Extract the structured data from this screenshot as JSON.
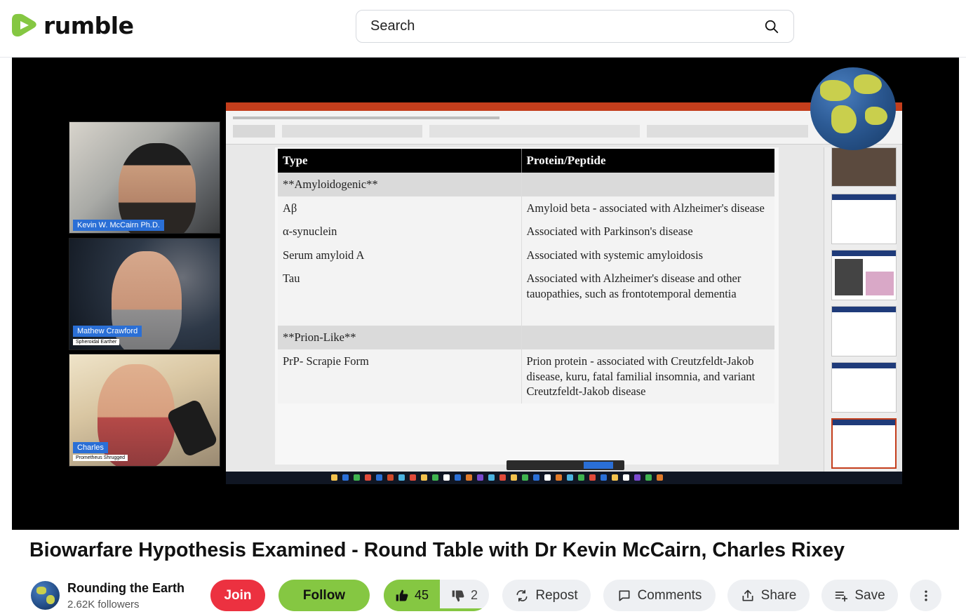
{
  "brand": {
    "name": "rumble",
    "accent": "#85c742"
  },
  "search": {
    "placeholder": "Search"
  },
  "video": {
    "participants": [
      {
        "name": "Kevin W. McCairn Ph.D.",
        "subtitle": ""
      },
      {
        "name": "Mathew Crawford",
        "subtitle": "Spheroidal Earther"
      },
      {
        "name": "Charles",
        "subtitle": "Prometheus Shrugged"
      }
    ],
    "slide": {
      "headers": [
        "Type",
        "Protein/Peptide"
      ],
      "sections": [
        {
          "title": "**Amyloidogenic**",
          "rows": [
            [
              "Aβ",
              "Amyloid beta - associated with Alzheimer's disease"
            ],
            [
              "α-synuclein",
              "Associated with Parkinson's disease"
            ],
            [
              "Serum amyloid A",
              "Associated with systemic amyloidosis"
            ],
            [
              "Tau",
              "Associated with Alzheimer's disease and other tauopathies, such as frontotemporal dementia"
            ]
          ]
        },
        {
          "title": "**Prion-Like**",
          "rows": [
            [
              "PrP- Scrapie Form",
              "Prion protein - associated with Creutzfeldt-Jakob disease, kuru, fatal familial insomnia, and variant Creutzfeldt-Jakob disease"
            ]
          ]
        }
      ]
    }
  },
  "title": "Biowarfare Hypothesis Examined - Round Table with Dr Kevin McCairn, Charles Rixey",
  "channel": {
    "name": "Rounding the Earth",
    "followers": "2.62K followers"
  },
  "actions": {
    "join": "Join",
    "follow": "Follow",
    "upvotes": "45",
    "downvotes": "2",
    "repost": "Repost",
    "comments": "Comments",
    "share": "Share",
    "save": "Save"
  },
  "colors": {
    "join": "#ec3140",
    "follow": "#85c742",
    "button_grey": "#eef0f3"
  }
}
